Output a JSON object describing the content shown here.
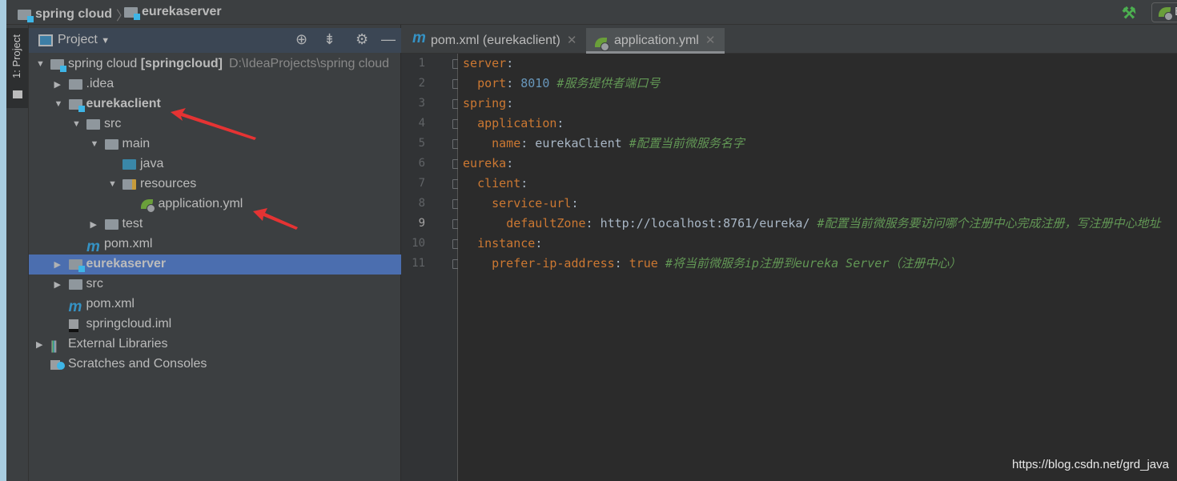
{
  "breadcrumb": [
    "spring cloud",
    "eurekaserver"
  ],
  "toolbar": {
    "run_config_label": "E"
  },
  "tool_window": {
    "label": "1: Project"
  },
  "project_panel": {
    "title": "Project"
  },
  "tree": [
    {
      "level": 0,
      "arrow": "down",
      "icon": "module-folder",
      "label": "spring cloud",
      "bold_suffix": "[springcloud]",
      "path": "D:\\IdeaProjects\\spring cloud"
    },
    {
      "level": 1,
      "arrow": "right",
      "icon": "folder",
      "label": ".idea"
    },
    {
      "level": 1,
      "arrow": "down",
      "icon": "module-folder",
      "label": "eurekaclient",
      "bold": true
    },
    {
      "level": 2,
      "arrow": "down",
      "icon": "folder",
      "label": "src"
    },
    {
      "level": 3,
      "arrow": "down",
      "icon": "folder",
      "label": "main"
    },
    {
      "level": 4,
      "arrow": "",
      "icon": "source-folder",
      "label": "java"
    },
    {
      "level": 4,
      "arrow": "down",
      "icon": "resources-folder",
      "label": "resources"
    },
    {
      "level": 5,
      "arrow": "",
      "icon": "spring-yml",
      "label": "application.yml"
    },
    {
      "level": 3,
      "arrow": "right",
      "icon": "folder",
      "label": "test"
    },
    {
      "level": 2,
      "arrow": "",
      "icon": "maven",
      "label": "pom.xml"
    },
    {
      "level": 1,
      "arrow": "right",
      "icon": "module-folder",
      "label": "eurekaserver",
      "bold": true,
      "selected": true
    },
    {
      "level": 1,
      "arrow": "right",
      "icon": "folder",
      "label": "src"
    },
    {
      "level": 1,
      "arrow": "",
      "icon": "maven",
      "label": "pom.xml"
    },
    {
      "level": 1,
      "arrow": "",
      "icon": "iml-file",
      "label": "springcloud.iml"
    },
    {
      "level": 0,
      "arrow": "right",
      "icon": "libraries",
      "label": "External Libraries"
    },
    {
      "level": 0,
      "arrow": "",
      "icon": "scratches",
      "label": "Scratches and Consoles"
    }
  ],
  "tabs": [
    {
      "label": "pom.xml (eurekaclient)",
      "icon": "maven"
    },
    {
      "label": "application.yml",
      "icon": "spring-yml",
      "active": true
    }
  ],
  "code": [
    [
      [
        "k",
        "server"
      ],
      [
        "v",
        ":"
      ]
    ],
    [
      [
        "v",
        "  "
      ],
      [
        "k",
        "port"
      ],
      [
        "v",
        ": "
      ],
      [
        "n",
        "8010"
      ],
      [
        "v",
        " "
      ],
      [
        "c",
        "#服务提供者端口号"
      ]
    ],
    [
      [
        "k",
        "spring"
      ],
      [
        "v",
        ":"
      ]
    ],
    [
      [
        "v",
        "  "
      ],
      [
        "k",
        "application"
      ],
      [
        "v",
        ":"
      ]
    ],
    [
      [
        "v",
        "    "
      ],
      [
        "k",
        "name"
      ],
      [
        "v",
        ": eurekaClient "
      ],
      [
        "c",
        "#配置当前微服务名字"
      ]
    ],
    [
      [
        "k",
        "eureka"
      ],
      [
        "v",
        ":"
      ]
    ],
    [
      [
        "v",
        "  "
      ],
      [
        "k",
        "client"
      ],
      [
        "v",
        ":"
      ]
    ],
    [
      [
        "v",
        "    "
      ],
      [
        "k",
        "service-url"
      ],
      [
        "v",
        ":"
      ]
    ],
    [
      [
        "v",
        "      "
      ],
      [
        "k",
        "defaultZone"
      ],
      [
        "v",
        ": http://localhost:8761/eureka/ "
      ],
      [
        "c",
        "#配置当前微服务要访问哪个注册中心完成注册，写注册中心地址"
      ]
    ],
    [
      [
        "v",
        "  "
      ],
      [
        "k",
        "instance"
      ],
      [
        "v",
        ":"
      ]
    ],
    [
      [
        "v",
        "    "
      ],
      [
        "k",
        "prefer-ip-address"
      ],
      [
        "v",
        ": "
      ],
      [
        "k",
        "true"
      ],
      [
        "v",
        " "
      ],
      [
        "c",
        "#将当前微服务ip注册到eureka Server（注册中心）"
      ]
    ]
  ],
  "current_line": 9,
  "watermark": "https://blog.csdn.net/grd_java",
  "colors": {
    "keyword": "#cc7832",
    "number": "#6897bb",
    "comment": "#629755",
    "selection": "#4b6eaf",
    "arrow": "#e53333"
  }
}
